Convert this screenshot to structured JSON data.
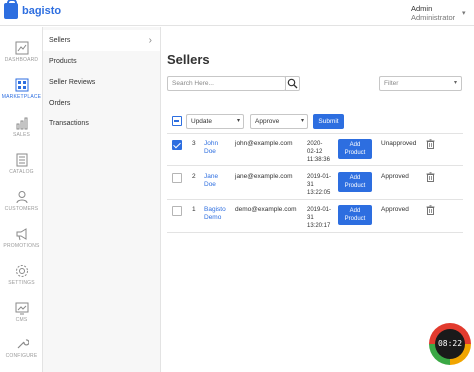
{
  "app": {
    "logo_text": "bagisto"
  },
  "user": {
    "name": "Admin",
    "role": "Administrator"
  },
  "nav": [
    {
      "label": "DASHBOARD",
      "icon": "dashboard-icon"
    },
    {
      "label": "MARKETPLACE",
      "icon": "marketplace-icon",
      "active": true
    },
    {
      "label": "SALES",
      "icon": "sales-icon"
    },
    {
      "label": "CATALOG",
      "icon": "catalog-icon"
    },
    {
      "label": "CUSTOMERS",
      "icon": "customers-icon"
    },
    {
      "label": "PROMOTIONS",
      "icon": "promotions-icon"
    },
    {
      "label": "SETTINGS",
      "icon": "settings-icon"
    },
    {
      "label": "CMS",
      "icon": "cms-icon"
    },
    {
      "label": "CONFIGURE",
      "icon": "configure-icon"
    }
  ],
  "subnav": [
    {
      "label": "Sellers",
      "active": true
    },
    {
      "label": "Products"
    },
    {
      "label": "Seller Reviews"
    },
    {
      "label": "Orders"
    },
    {
      "label": "Transactions"
    }
  ],
  "page": {
    "title": "Sellers",
    "search_placeholder": "Search Here...",
    "filter_placeholder": "Filter"
  },
  "mass_action": {
    "action_value": "Update",
    "status_value": "Approve",
    "submit_label": "Submit"
  },
  "rows": [
    {
      "id": "3",
      "name_line1": "John",
      "name_line2": "Doe",
      "email": "john@example.com",
      "date_l1": "2020-",
      "date_l2": "02-12",
      "date_l3": "11:38:36",
      "btn_l1": "Add",
      "btn_l2": "Product",
      "status": "Unapproved",
      "checked": true
    },
    {
      "id": "2",
      "name_line1": "Jane",
      "name_line2": "Doe",
      "email": "jane@example.com",
      "date_l1": "2019-01-",
      "date_l2": "31",
      "date_l3": "13:22:05",
      "btn_l1": "Add",
      "btn_l2": "Product",
      "status": "Approved",
      "checked": false
    },
    {
      "id": "1",
      "name_line1": "Bagisto",
      "name_line2": "Demo",
      "email": "demo@example.com",
      "date_l1": "2019-01-",
      "date_l2": "31",
      "date_l3": "13:20:17",
      "btn_l1": "Add",
      "btn_l2": "Product",
      "status": "Approved",
      "checked": false
    }
  ],
  "timer": {
    "text": "08:22"
  },
  "colors": {
    "accent": "#2d6ee0"
  }
}
